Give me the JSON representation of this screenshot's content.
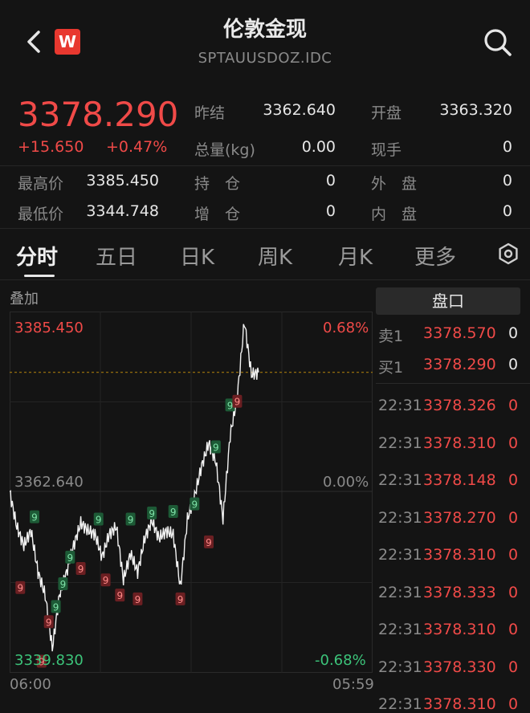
{
  "header": {
    "title": "伦敦金现",
    "code": "SPTAUUSDOZ.IDC",
    "logo_text": "W",
    "back_icon": "chevron-left-icon",
    "search_icon": "search-icon"
  },
  "quote": {
    "price": "3378.290",
    "change": "+15.650",
    "change_pct": "+0.47%",
    "stats": [
      {
        "label": "昨结",
        "value": "3362.640"
      },
      {
        "label": "开盘",
        "value": "3363.320"
      },
      {
        "label": "总量(kg)",
        "value": "0.00"
      },
      {
        "label": "现手",
        "value": "0"
      },
      {
        "label": "最高价",
        "value": "3385.450"
      },
      {
        "label": "持　仓",
        "value": "0"
      },
      {
        "label": "外　盘",
        "value": "0"
      },
      {
        "label": "最低价",
        "value": "3344.748"
      },
      {
        "label": "增　仓",
        "value": "0"
      },
      {
        "label": "内　盘",
        "value": "0"
      }
    ]
  },
  "tabs": [
    "分时",
    "五日",
    "日K",
    "周K",
    "月K",
    "更多"
  ],
  "active_tab": 0,
  "chart": {
    "overlay_label": "叠加",
    "high": "3385.450",
    "mid": "3362.640",
    "low": "3339.830",
    "pct_high": "0.68%",
    "pct_mid": "0.00%",
    "pct_low": "-0.68%",
    "time_start": "06:00",
    "time_end": "05:59",
    "marker_label": "9"
  },
  "chart_data": {
    "type": "line",
    "ylim": [
      3339.83,
      3385.45
    ],
    "reference": 3362.64,
    "current": 3378.29,
    "x": [
      0,
      2,
      4,
      6,
      8,
      10,
      12,
      14,
      16,
      18,
      20,
      22,
      24,
      26,
      28,
      30,
      32,
      34,
      36,
      38,
      40,
      42,
      44,
      46,
      48,
      50,
      52,
      54,
      56,
      58,
      60,
      62,
      64,
      66,
      68,
      70
    ],
    "values": [
      3362.6,
      3358,
      3355.5,
      3357.5,
      3352,
      3349,
      3342,
      3349,
      3352,
      3355.5,
      3358.5,
      3357.5,
      3357,
      3354,
      3357,
      3358,
      3351,
      3354.5,
      3352,
      3356.5,
      3358.8,
      3356.5,
      3357.4,
      3357,
      3350,
      3359,
      3362,
      3366,
      3369,
      3366.5,
      3359,
      3370,
      3375,
      3385,
      3378,
      3378.3
    ],
    "markers": [
      {
        "x": 7,
        "value": 3359.3,
        "color": "green"
      },
      {
        "x": 13,
        "value": 3347.5,
        "color": "green"
      },
      {
        "x": 15,
        "value": 3350.5,
        "color": "green"
      },
      {
        "x": 17,
        "value": 3354,
        "color": "green"
      },
      {
        "x": 25,
        "value": 3359,
        "color": "green"
      },
      {
        "x": 34,
        "value": 3359,
        "color": "green"
      },
      {
        "x": 40,
        "value": 3359.8,
        "color": "green"
      },
      {
        "x": 46,
        "value": 3360,
        "color": "green"
      },
      {
        "x": 52,
        "value": 3361,
        "color": "green"
      },
      {
        "x": 58,
        "value": 3368.5,
        "color": "green"
      },
      {
        "x": 62,
        "value": 3374,
        "color": "green"
      },
      {
        "x": 3,
        "value": 3350,
        "color": "red"
      },
      {
        "x": 11,
        "value": 3345.5,
        "color": "red"
      },
      {
        "x": 20,
        "value": 3352.5,
        "color": "red"
      },
      {
        "x": 27,
        "value": 3351,
        "color": "red"
      },
      {
        "x": 31,
        "value": 3349,
        "color": "red"
      },
      {
        "x": 36,
        "value": 3348.5,
        "color": "red"
      },
      {
        "x": 48,
        "value": 3348.5,
        "color": "red"
      },
      {
        "x": 56,
        "value": 3356,
        "color": "red"
      },
      {
        "x": 64,
        "value": 3374.5,
        "color": "red"
      },
      {
        "x": 9,
        "value": 3340.3,
        "color": "red"
      }
    ]
  },
  "order_book": {
    "button": "盘口",
    "sell": {
      "label": "卖1",
      "price": "3378.570",
      "vol": "0"
    },
    "buy": {
      "label": "买1",
      "price": "3378.290",
      "vol": "0"
    }
  },
  "ticks": [
    {
      "time": "22:31",
      "price": "3378.326",
      "vol": "0"
    },
    {
      "time": "22:31",
      "price": "3378.310",
      "vol": "0"
    },
    {
      "time": "22:31",
      "price": "3378.148",
      "vol": "0"
    },
    {
      "time": "22:31",
      "price": "3378.270",
      "vol": "0"
    },
    {
      "time": "22:31",
      "price": "3378.310",
      "vol": "0"
    },
    {
      "time": "22:31",
      "price": "3378.333",
      "vol": "0"
    },
    {
      "time": "22:31",
      "price": "3378.310",
      "vol": "0"
    },
    {
      "time": "22:31",
      "price": "3378.330",
      "vol": "0"
    },
    {
      "time": "22:31",
      "price": "3378.310",
      "vol": "0"
    }
  ],
  "colors": {
    "up": "#f04a48",
    "down": "#3cc47a",
    "background": "#141414"
  }
}
